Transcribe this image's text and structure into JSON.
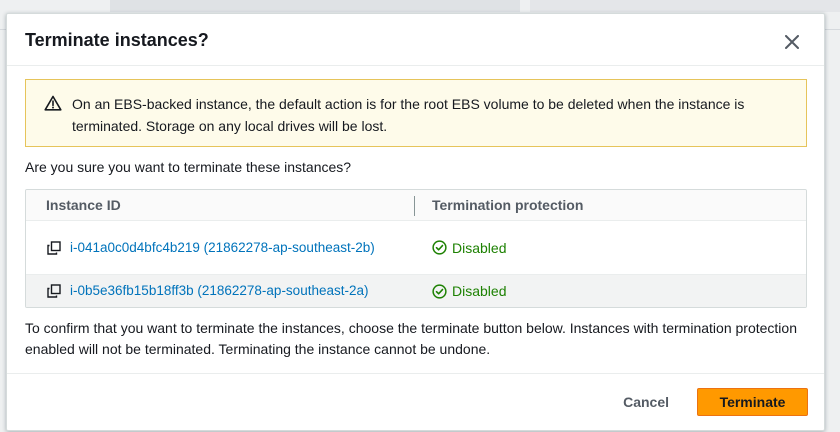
{
  "modal": {
    "title": "Terminate instances?",
    "close_icon": "close-icon"
  },
  "alert": {
    "icon": "warning-icon",
    "text": "On an EBS-backed instance, the default action is for the root EBS volume to be deleted when the instance is terminated. Storage on any local drives will be lost."
  },
  "question": "Are you sure you want to terminate these instances?",
  "table": {
    "headers": [
      "Instance ID",
      "Termination protection"
    ],
    "rows": [
      {
        "instance": "i-041a0c0d4bfc4b219 (21862278-ap-southeast-2b)",
        "protection": "Disabled"
      },
      {
        "instance": "i-0b5e36fb15b18ff3b (21862278-ap-southeast-2a)",
        "protection": "Disabled"
      }
    ]
  },
  "confirm_text": "To confirm that you want to terminate the instances, choose the terminate button below. Instances with termination protection enabled will not be terminated. Terminating the instance cannot be undone.",
  "footer": {
    "cancel_label": "Cancel",
    "terminate_label": "Terminate"
  },
  "colors": {
    "primary_button": "#ff9900",
    "link": "#0073bb",
    "success": "#1d8102",
    "alert_bg": "#fefbea",
    "alert_border": "#e6c45a"
  }
}
